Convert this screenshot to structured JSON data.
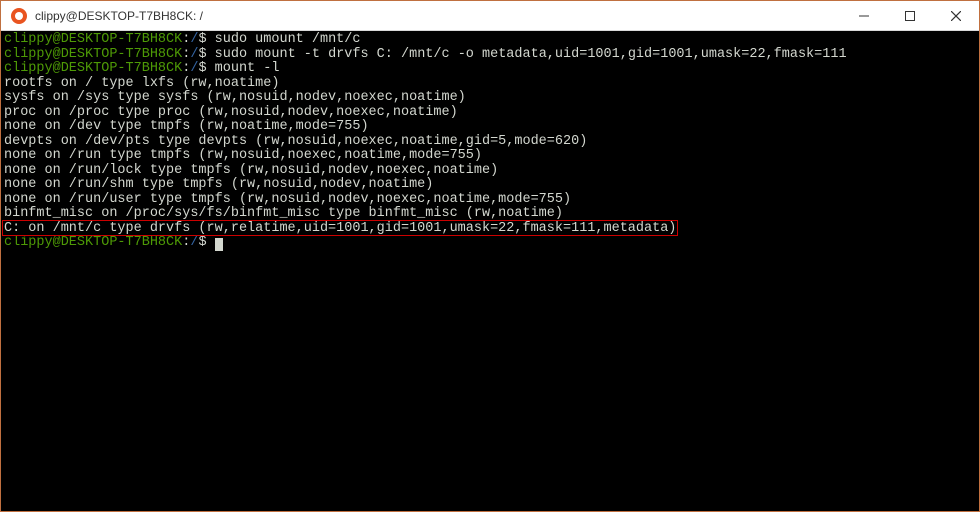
{
  "window": {
    "title": "clippy@DESKTOP-T7BH8CK: /"
  },
  "prompt": {
    "userhost": "clippy@DESKTOP-T7BH8CK",
    "sep1": ":",
    "cwd": "/",
    "sep2": "$ "
  },
  "commands": [
    "sudo umount /mnt/c",
    "sudo mount -t drvfs C: /mnt/c -o metadata,uid=1001,gid=1001,umask=22,fmask=111",
    "mount -l"
  ],
  "output": [
    "rootfs on / type lxfs (rw,noatime)",
    "sysfs on /sys type sysfs (rw,nosuid,nodev,noexec,noatime)",
    "proc on /proc type proc (rw,nosuid,nodev,noexec,noatime)",
    "none on /dev type tmpfs (rw,noatime,mode=755)",
    "devpts on /dev/pts type devpts (rw,nosuid,noexec,noatime,gid=5,mode=620)",
    "none on /run type tmpfs (rw,nosuid,noexec,noatime,mode=755)",
    "none on /run/lock type tmpfs (rw,nosuid,nodev,noexec,noatime)",
    "none on /run/shm type tmpfs (rw,nosuid,nodev,noatime)",
    "none on /run/user type tmpfs (rw,nosuid,nodev,noexec,noatime,mode=755)",
    "binfmt_misc on /proc/sys/fs/binfmt_misc type binfmt_misc (rw,noatime)",
    "C: on /mnt/c type drvfs (rw,relatime,uid=1001,gid=1001,umask=22,fmask=111,metadata)"
  ],
  "highlight": {
    "line_index": 10
  }
}
